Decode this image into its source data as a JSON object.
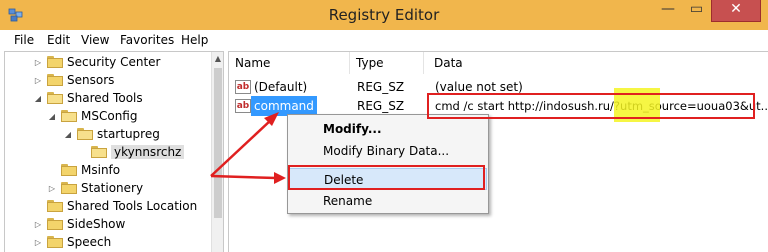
{
  "window": {
    "title": "Registry Editor",
    "close_glyph": "✕",
    "min_glyph": "—",
    "max_glyph": "▭"
  },
  "menu": [
    "File",
    "Edit",
    "View",
    "Favorites",
    "Help"
  ],
  "tree": {
    "items": [
      {
        "label": "Security Center",
        "expander": "▷"
      },
      {
        "label": "Sensors",
        "expander": "▷"
      },
      {
        "label": "Shared Tools",
        "expander": "◢"
      },
      {
        "label": "MSConfig",
        "expander": "◢"
      },
      {
        "label": "startupreg",
        "expander": "◢"
      },
      {
        "label": "ykynnsrchz",
        "expander": ""
      },
      {
        "label": "Msinfo",
        "expander": ""
      },
      {
        "label": "Stationery",
        "expander": "▷"
      },
      {
        "label": "Shared Tools Location",
        "expander": ""
      },
      {
        "label": "SideShow",
        "expander": "▷"
      },
      {
        "label": "Speech",
        "expander": "▷"
      }
    ]
  },
  "values": {
    "headers": [
      "Name",
      "Type",
      "Data"
    ],
    "rows": [
      {
        "name": "(Default)",
        "type": "REG_SZ",
        "data": "(value not set)"
      },
      {
        "name": "command",
        "type": "REG_SZ",
        "data": "cmd /c start http://indosush.ru/?utm_source=uoua03&ut..."
      }
    ],
    "icon_text": "ab"
  },
  "context_menu": {
    "items": [
      "Modify...",
      "Modify Binary Data...",
      "Delete",
      "Rename"
    ]
  },
  "colors": {
    "titlebar": "#f1b64c",
    "selection": "#3399ff",
    "annotation_red": "#e02020",
    "highlight_yellow": "#f5f523"
  }
}
